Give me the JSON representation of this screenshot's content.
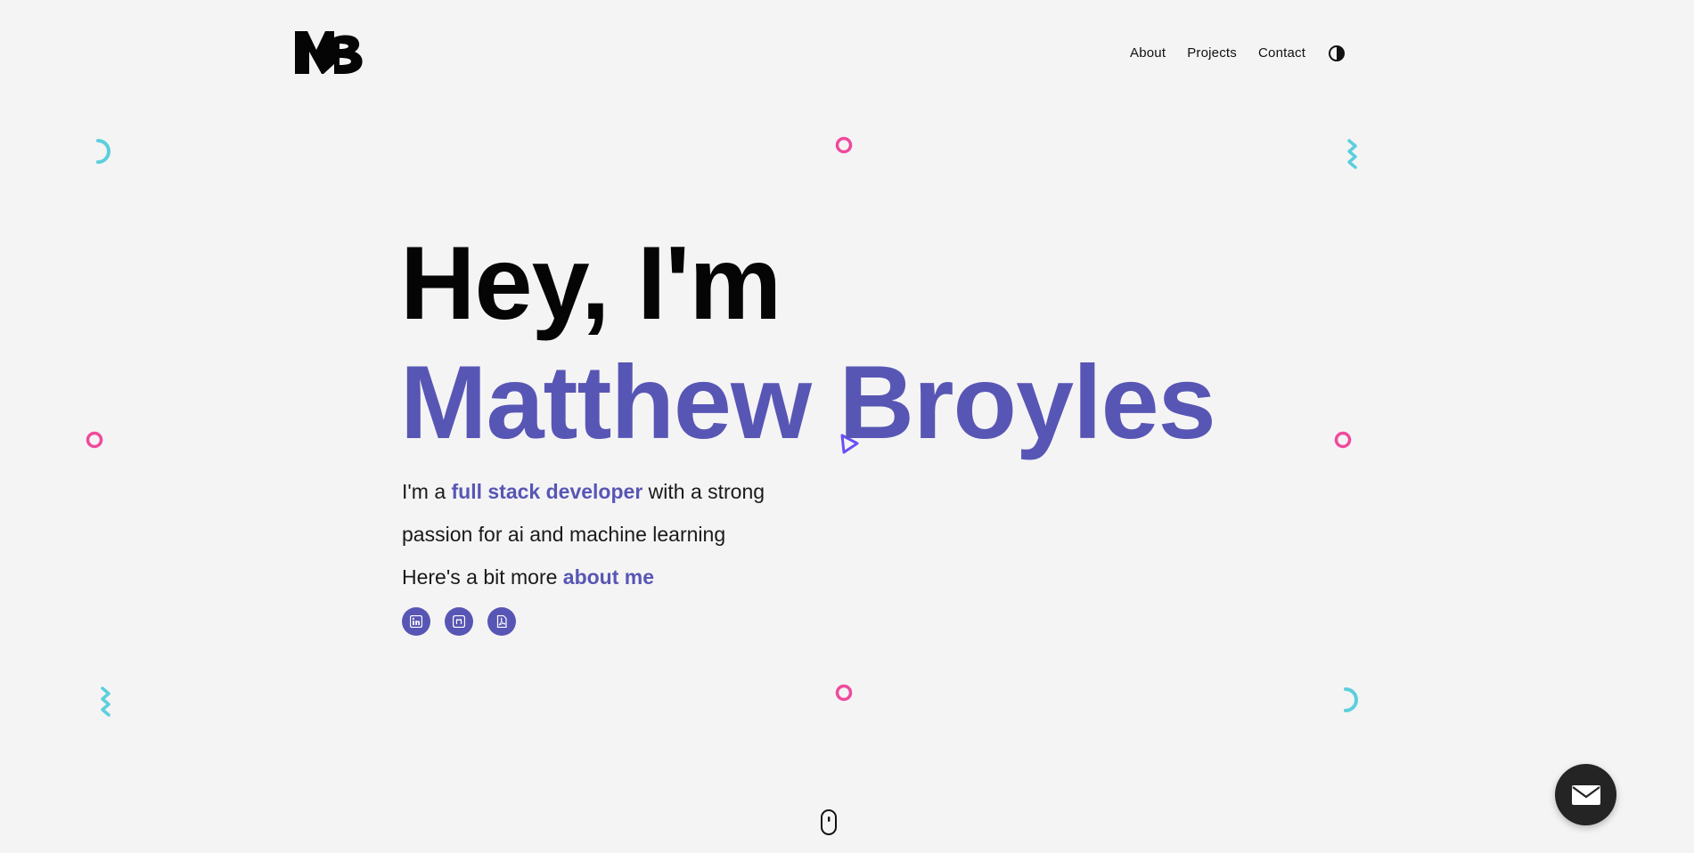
{
  "header": {
    "logo_text": "MB",
    "nav": [
      {
        "label": "About"
      },
      {
        "label": "Projects"
      },
      {
        "label": "Contact"
      }
    ],
    "theme_toggle_icon": "half-circle-contrast-icon"
  },
  "hero": {
    "greeting": "Hey, I'm",
    "name": "Matthew Broyles",
    "intro": {
      "prefix": "I'm a ",
      "highlight": "full stack developer",
      "suffix": " with a strong",
      "line2": "passion for ai and machine learning",
      "line3_prefix": "Here's a bit more ",
      "line3_link": "about me"
    }
  },
  "socials": [
    {
      "icon": "linkedin-icon"
    },
    {
      "icon": "github-icon"
    },
    {
      "icon": "resume-pdf-icon"
    }
  ],
  "scroll_indicator_icon": "mouse-scroll-icon",
  "contact_fab_icon": "envelope-icon",
  "colors": {
    "background": "#f4f4f5",
    "accent": "#5856b4",
    "pink": "#ef4a9c",
    "cyan": "#5ccfdc",
    "triangle": "#6a4ff5",
    "fab": "#242424"
  }
}
